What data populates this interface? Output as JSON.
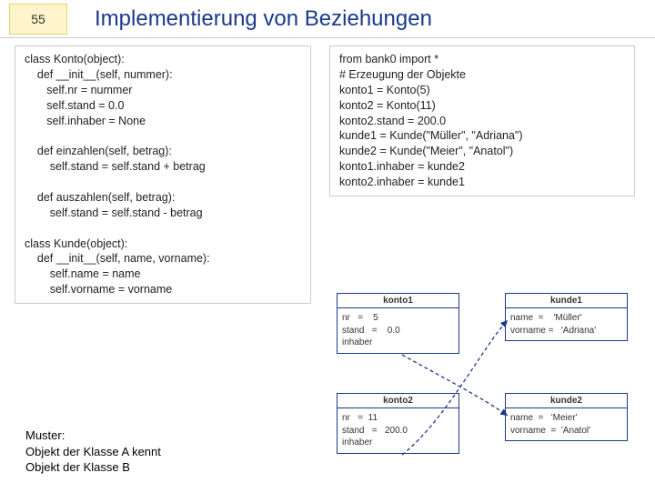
{
  "slide_number": "55",
  "title": "Implementierung von Beziehungen",
  "left_code": "class Konto(object):\n    def __init__(self, nummer):\n       self.nr = nummer\n       self.stand = 0.0\n       self.inhaber = None\n\n    def einzahlen(self, betrag):\n        self.stand = self.stand + betrag\n\n    def auszahlen(self, betrag):\n        self.stand = self.stand - betrag\n\nclass Kunde(object):\n    def __init__(self, name, vorname):\n        self.name = name\n        self.vorname = vorname",
  "right_code": "from bank0 import *\n# Erzeugung der Objekte\nkonto1 = Konto(5)\nkonto2 = Konto(11)\nkonto2.stand = 200.0\nkunde1 = Kunde(\"Müller\", \"Adriana\")\nkunde2 = Kunde(\"Meier\", \"Anatol\")\nkonto1.inhaber = kunde2\nkonto2.inhaber = kunde1",
  "footer": "Muster:\nObjekt der Klasse A kennt\nObjekt der Klasse B",
  "diagram": {
    "konto1": {
      "name": "konto1",
      "body": "nr   =    5\nstand   =    0.0\ninhaber"
    },
    "kunde1": {
      "name": "kunde1",
      "body": "name  =    'Müller'\nvorname =   'Adriana'"
    },
    "konto2": {
      "name": "konto2",
      "body": "nr   =  11\nstand   =   200.0\ninhaber"
    },
    "kunde2": {
      "name": "kunde2",
      "body": "name  =   'Meier'\nvorname  =  'Anatol'"
    }
  }
}
